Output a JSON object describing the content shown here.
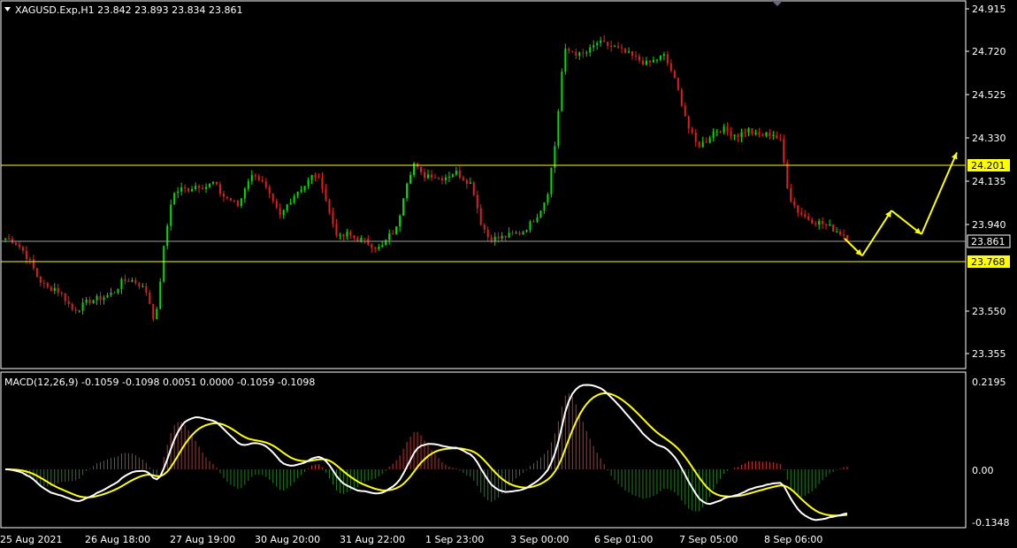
{
  "header": {
    "symbol_line": "XAGUSD.Exp,H1  23.842 23.893 23.834 23.861"
  },
  "macd": {
    "label": "MACD(12,26,9) -0.1059 -0.1098 0.0051 0.0000 -0.1059 -0.1098"
  },
  "price_axis": [
    "24.915",
    "24.720",
    "24.525",
    "24.330",
    "24.135",
    "23.940",
    "23.550",
    "23.355"
  ],
  "price_tags": {
    "upper": "24.201",
    "current": "23.861",
    "lower": "23.768"
  },
  "macd_axis": [
    "0.2195",
    "0.00",
    "-0.1348"
  ],
  "time_axis": [
    "25 Aug 2021",
    "26 Aug 18:00",
    "27 Aug 19:00",
    "30 Aug 20:00",
    "31 Aug 22:00",
    "1 Sep 23:00",
    "3 Sep 00:00",
    "6 Sep 01:00",
    "7 Sep 05:00",
    "8 Sep 06:00"
  ],
  "colors": {
    "background": "#000000",
    "bull": "#00e000",
    "bear": "#e02020",
    "level_line": "#ffff00",
    "current_line": "#a0a0a0",
    "macd_line": "#ffffff",
    "signal_line": "#ffff00"
  },
  "chart_data": {
    "type": "candlestick",
    "series": [
      {
        "name": "XAGUSD.Exp,H1",
        "close_path": [
          23.85,
          23.84,
          23.8,
          23.74,
          23.66,
          23.62,
          23.62,
          23.58,
          23.52,
          23.53,
          23.56,
          23.57,
          23.58,
          23.6,
          23.65,
          23.66,
          23.64,
          23.6,
          23.45,
          23.8,
          24.05,
          24.08,
          24.08,
          24.1,
          24.09,
          24.11,
          24.05,
          24.03,
          24.0,
          24.12,
          24.15,
          24.1,
          24.02,
          23.95,
          24.02,
          24.07,
          24.1,
          24.15,
          24.1,
          23.95,
          23.85,
          23.87,
          23.85,
          23.84,
          23.82,
          23.8,
          23.86,
          23.9,
          24.1,
          24.2,
          24.14,
          24.15,
          24.13,
          24.14,
          24.16,
          24.13,
          24.1,
          23.93,
          23.85,
          23.85,
          23.86,
          23.87,
          23.88,
          23.92,
          23.97,
          24.05,
          24.3,
          24.72,
          24.72,
          24.7,
          24.72,
          24.76,
          24.75,
          24.74,
          24.72,
          24.7,
          24.68,
          24.66,
          24.68,
          24.7,
          24.62,
          24.5,
          24.36,
          24.28,
          24.3,
          24.35,
          24.36,
          24.34,
          24.33,
          24.36,
          24.33,
          24.33,
          24.34,
          24.3,
          24.05,
          23.98,
          23.95,
          23.93,
          23.92,
          23.9,
          23.88,
          23.86
        ]
      },
      {
        "name": "MACD(12,26,9)"
      }
    ],
    "horizontal_levels": [
      24.201,
      23.861,
      23.768
    ],
    "projection": {
      "points": [
        23.85,
        23.77,
        23.98,
        23.87,
        24.25
      ]
    },
    "price_range": [
      23.25,
      24.95
    ],
    "macd_range": [
      -0.1348,
      0.2195
    ],
    "grid": false
  }
}
